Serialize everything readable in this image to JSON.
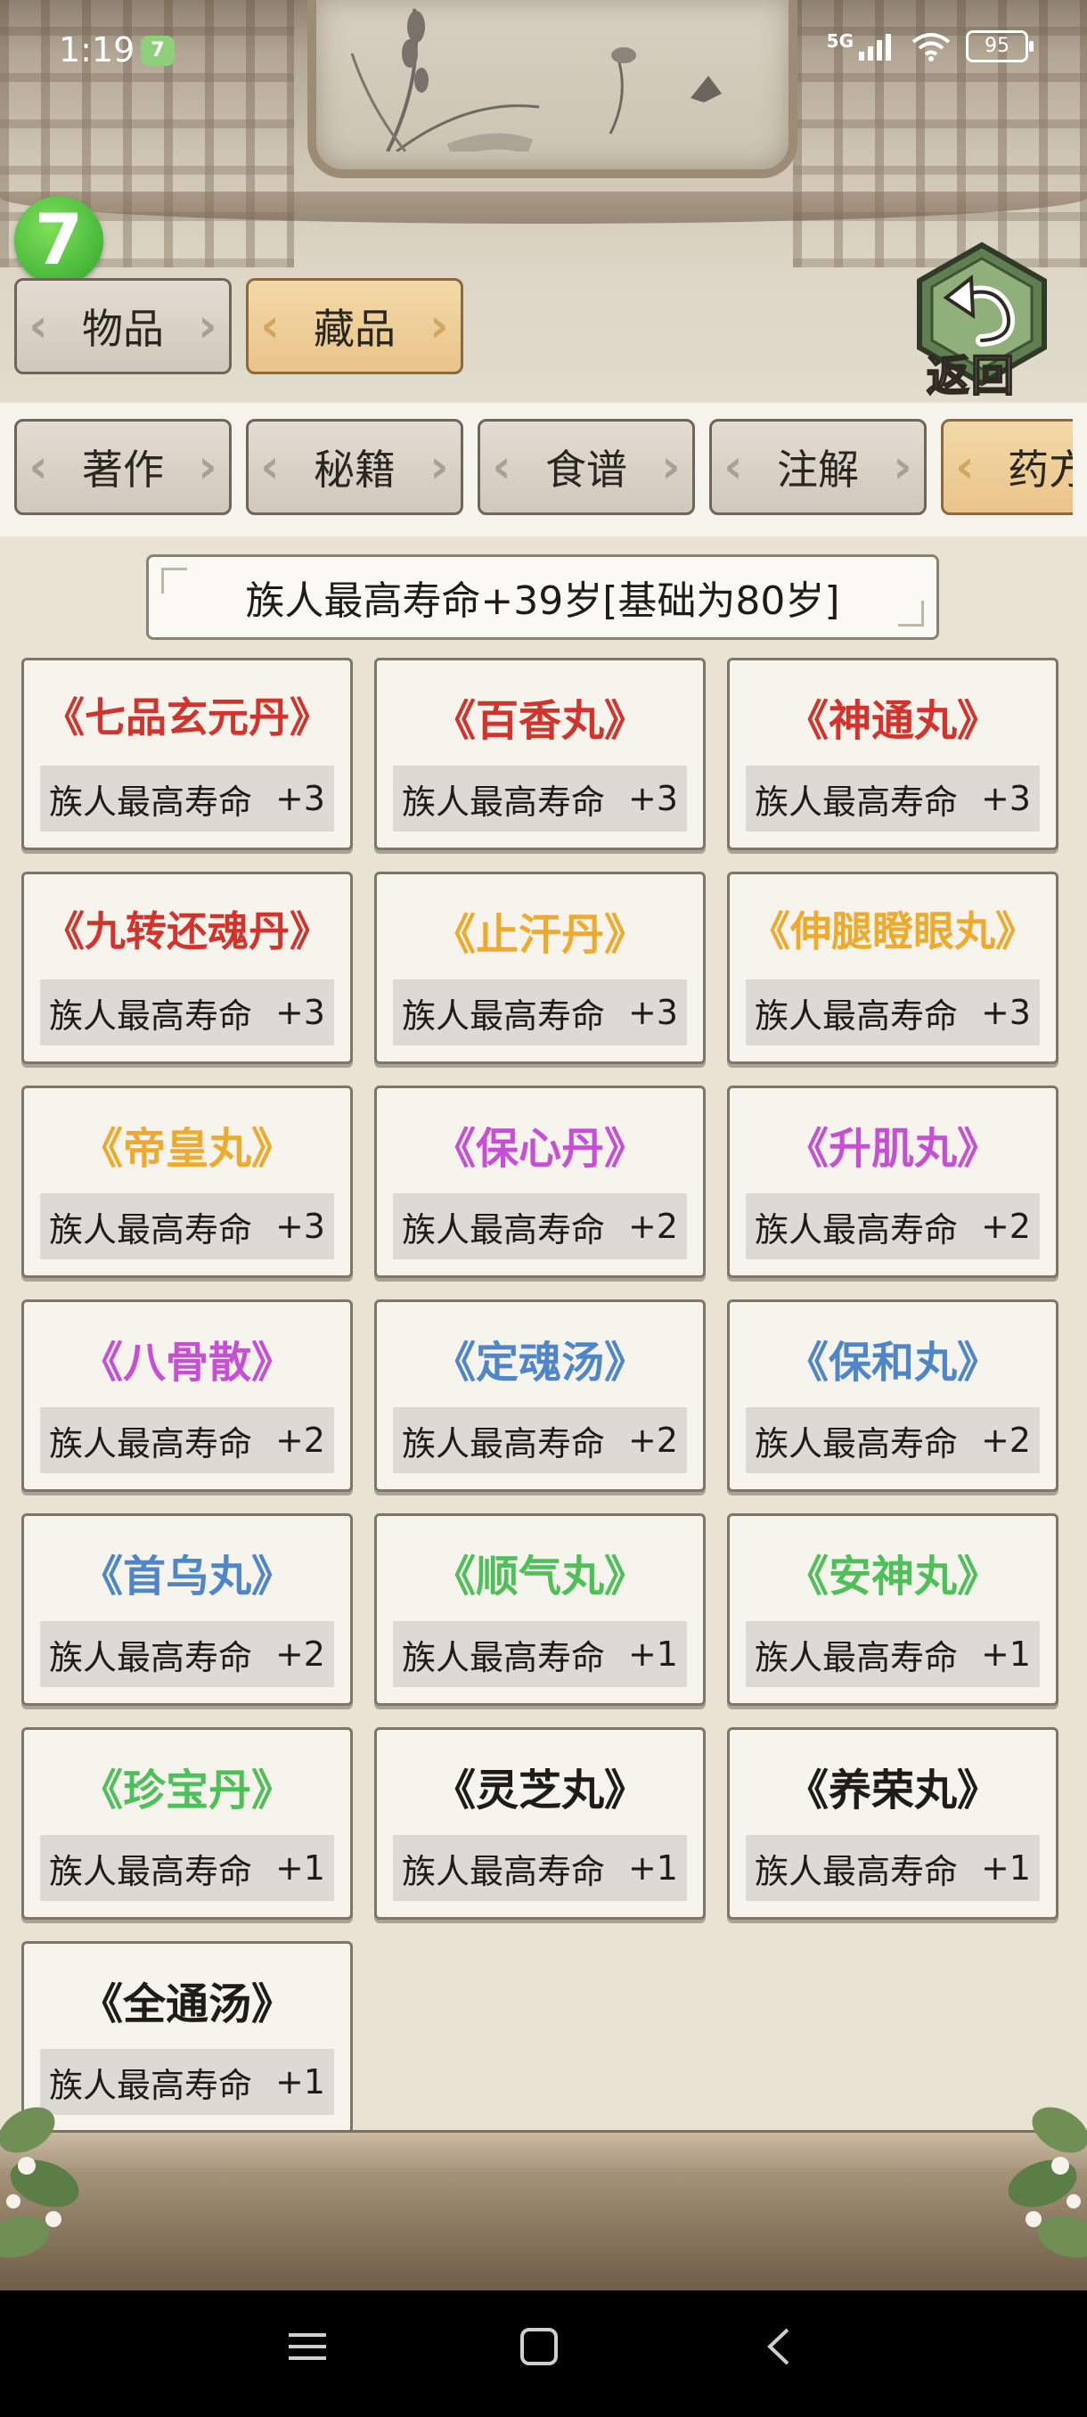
{
  "status_bar": {
    "time": "1:19",
    "network": "5G",
    "battery": "95"
  },
  "badge": {
    "label": "7"
  },
  "main_tabs": [
    {
      "label": "物品",
      "active": false
    },
    {
      "label": "藏品",
      "active": true
    }
  ],
  "return_button": {
    "label": "返回"
  },
  "category_tabs": [
    {
      "label": "著作",
      "active": false
    },
    {
      "label": "秘籍",
      "active": false
    },
    {
      "label": "食谱",
      "active": false
    },
    {
      "label": "注解",
      "active": false
    },
    {
      "label": "药方",
      "active": true
    }
  ],
  "banner": {
    "text": "族人最高寿命+39岁[基础为80岁]"
  },
  "colors": {
    "red": "#d2332b",
    "orange": "#eeaa2d",
    "purple": "#c74fd6",
    "blue": "#4f86c9",
    "green": "#4fbf5a",
    "black": "#1f1c18"
  },
  "items": [
    {
      "name": "《七品玄元丹》",
      "effect": "族人最高寿命",
      "value": "+3",
      "color": "#d2332b"
    },
    {
      "name": "《百香丸》",
      "effect": "族人最高寿命",
      "value": "+3",
      "color": "#d2332b"
    },
    {
      "name": "《神通丸》",
      "effect": "族人最高寿命",
      "value": "+3",
      "color": "#d2332b"
    },
    {
      "name": "《九转还魂丹》",
      "effect": "族人最高寿命",
      "value": "+3",
      "color": "#d2332b"
    },
    {
      "name": "《止汗丹》",
      "effect": "族人最高寿命",
      "value": "+3",
      "color": "#eeaa2d"
    },
    {
      "name": "《伸腿瞪眼丸》",
      "effect": "族人最高寿命",
      "value": "+3",
      "color": "#eeaa2d"
    },
    {
      "name": "《帝皇丸》",
      "effect": "族人最高寿命",
      "value": "+3",
      "color": "#eeaa2d"
    },
    {
      "name": "《保心丹》",
      "effect": "族人最高寿命",
      "value": "+2",
      "color": "#c74fd6"
    },
    {
      "name": "《升肌丸》",
      "effect": "族人最高寿命",
      "value": "+2",
      "color": "#c74fd6"
    },
    {
      "name": "《八骨散》",
      "effect": "族人最高寿命",
      "value": "+2",
      "color": "#c74fd6"
    },
    {
      "name": "《定魂汤》",
      "effect": "族人最高寿命",
      "value": "+2",
      "color": "#4f86c9"
    },
    {
      "name": "《保和丸》",
      "effect": "族人最高寿命",
      "value": "+2",
      "color": "#4f86c9"
    },
    {
      "name": "《首乌丸》",
      "effect": "族人最高寿命",
      "value": "+2",
      "color": "#4f86c9"
    },
    {
      "name": "《顺气丸》",
      "effect": "族人最高寿命",
      "value": "+1",
      "color": "#4fbf5a"
    },
    {
      "name": "《安神丸》",
      "effect": "族人最高寿命",
      "value": "+1",
      "color": "#4fbf5a"
    },
    {
      "name": "《珍宝丹》",
      "effect": "族人最高寿命",
      "value": "+1",
      "color": "#4fbf5a"
    },
    {
      "name": "《灵芝丸》",
      "effect": "族人最高寿命",
      "value": "+1",
      "color": "#1f1c18"
    },
    {
      "name": "《养荣丸》",
      "effect": "族人最高寿命",
      "value": "+1",
      "color": "#1f1c18"
    },
    {
      "name": "《全通汤》",
      "effect": "族人最高寿命",
      "value": "+1",
      "color": "#1f1c18"
    }
  ],
  "nav_bar": {
    "menu_icon": "menu-icon",
    "home_icon": "home-icon",
    "back_icon": "back-icon"
  }
}
